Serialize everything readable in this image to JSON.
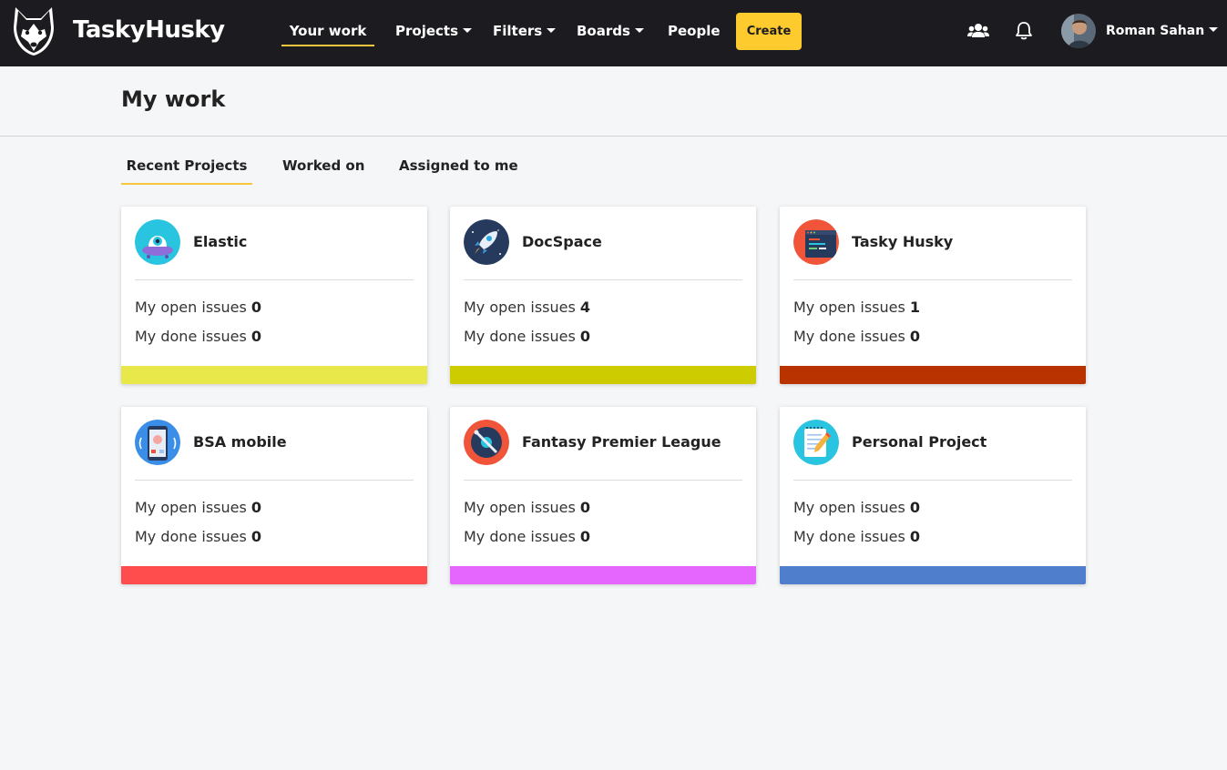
{
  "app": {
    "brand": "TaskyHusky"
  },
  "nav": {
    "your_work": "Your work",
    "projects": "Projects",
    "filters": "Filters",
    "boards": "Boards",
    "people": "People",
    "create": "Create"
  },
  "user": {
    "name": "Roman Sahan"
  },
  "page": {
    "title": "My work"
  },
  "tabs": [
    "Recent Projects",
    "Worked on",
    "Assigned to me"
  ],
  "labels": {
    "open": "My open issues",
    "done": "My done issues"
  },
  "projects": [
    {
      "name": "Elastic",
      "open": "0",
      "done": "0",
      "color": "#e8e84a",
      "icon": "alien-ufo-icon"
    },
    {
      "name": "DocSpace",
      "open": "4",
      "done": "0",
      "color": "#cccc00",
      "icon": "rocket-icon"
    },
    {
      "name": "Tasky Husky",
      "open": "1",
      "done": "0",
      "color": "#b83300",
      "icon": "code-window-icon"
    },
    {
      "name": "BSA mobile",
      "open": "0",
      "done": "0",
      "color": "#ff4d4d",
      "icon": "mobile-phone-icon"
    },
    {
      "name": "Fantasy Premier League",
      "open": "0",
      "done": "0",
      "color": "#e566ff",
      "icon": "vinyl-disc-icon"
    },
    {
      "name": "Personal Project",
      "open": "0",
      "done": "0",
      "color": "#4f7fcc",
      "icon": "notepad-pencil-icon"
    }
  ],
  "colors": {
    "topbar": "#1c1b1f",
    "accent": "#fdcb2e",
    "tab_underline": "#f6c63d"
  }
}
